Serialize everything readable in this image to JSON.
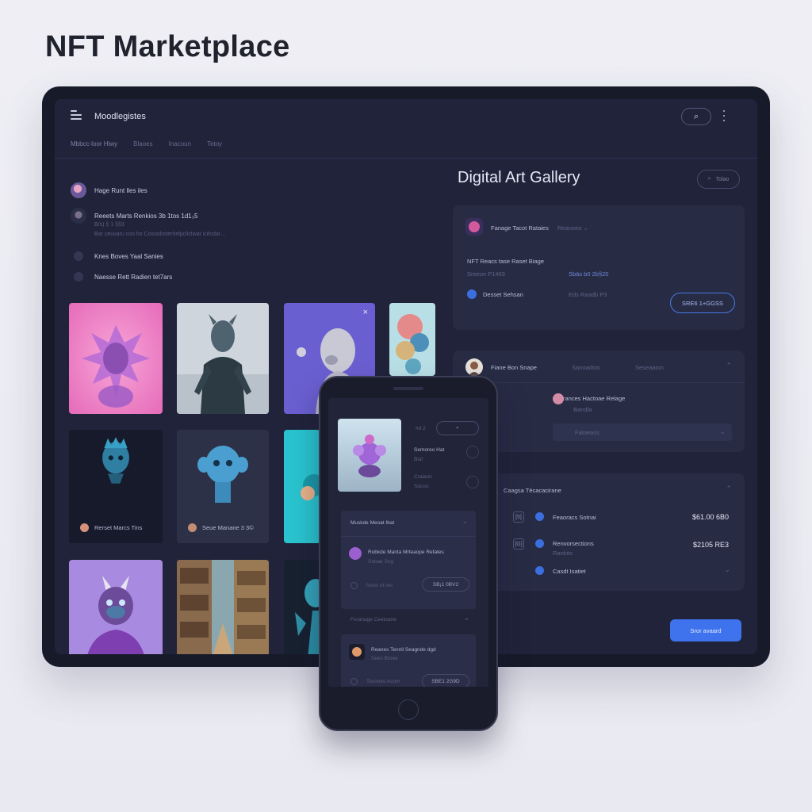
{
  "page": {
    "title": "NFT Marketplace"
  },
  "header": {
    "app_name": "Moodlegistes",
    "search_icon": "search-icon",
    "menu_icon": "hamburger-icon"
  },
  "tabs": [
    "Mbbcc-loor Hiwy",
    "Blaoes",
    "Inacoun",
    "Tetoy"
  ],
  "activity": [
    {
      "text": "Hage Runt lles iles",
      "sub": ""
    },
    {
      "text": "Reeets Marts Renkios 3b 1tos 1d1₃5",
      "sub": "B/s) § 1 §§3"
    },
    {
      "text": "",
      "sub": "Bar ceuvaru coo ho Cosoobsterhelpclictwat icécdar…"
    },
    {
      "text": "Knes Boves Yaal Sanies",
      "sub": ""
    },
    {
      "text": "Naesse Rett Radien tet7ars",
      "sub": ""
    }
  ],
  "cards": [
    {
      "label": ""
    },
    {
      "label": ""
    },
    {
      "label": ""
    },
    {
      "label": ""
    },
    {
      "label": "Rerset Marcs Tins"
    },
    {
      "label": "Seue Manane 3 3©"
    },
    {
      "label": ""
    },
    {
      "label": ""
    },
    {
      "label": ""
    },
    {
      "label": ""
    }
  ],
  "gallery": {
    "title": "Digital Art Gallery",
    "search_placeholder": "Tolao",
    "panel1": {
      "user": "Fanage Tacot Rataies",
      "dropdown": "Reanoeo",
      "item_title": "NFT Reacs tase Raset Biage",
      "item_sub": "Sreeon P1469",
      "price_link": "Sbäs b0 2b§20",
      "status": "Desset Sehsan",
      "status_value": "Eds Raadb P3",
      "button": "SRE6 1+GGSS"
    },
    "panel2": {
      "user": "Fiane Bon Snape",
      "col1": "Sanoadtos",
      "col2": "Seseaaton",
      "entry_title": "Feurances Hactoae Relage",
      "entry_sub": "Bandla",
      "select": "Fatoeass"
    },
    "panel3": {
      "title": "Caagsa Técacacirane",
      "rows": [
        {
          "icon": "[5]",
          "label": "Feaoracs Sotnai",
          "price": "$61.00 6B0"
        },
        {
          "icon": "[G]",
          "label": "Renvorsections",
          "sub": "Rankits",
          "price": "$2105 RE3"
        },
        {
          "icon": "",
          "label": "Casdt Isatiet",
          "price": ""
        }
      ]
    },
    "cta": "Sror avaard"
  },
  "phone": {
    "badge": "#d 2",
    "item_name": "Semoreo Hat",
    "item_sub": "Biaf",
    "item_sub2": "Cralaon",
    "item_sub3": "Sdcoo",
    "card1_title": "Muskde Meoat Ibat",
    "card1_user": "Robkde Manta Mrteaope Refates",
    "card1_sub": "Sebae Sog",
    "card1_left": "Noos nt res",
    "card1_pill": "SB¡1 0BV2",
    "divider_text": "Feranage Ceetoane",
    "card2_user": "Reanes Tennll Seagnde dgd",
    "card2_sub": "Sees Bdrée",
    "card2_left": "Tosones Acom",
    "card2_pill": "SBE1 2G9D"
  },
  "colors": {
    "accent": "#3f73ee",
    "panel": "#272b44",
    "screen": "#20233a",
    "frame": "#171a29"
  }
}
